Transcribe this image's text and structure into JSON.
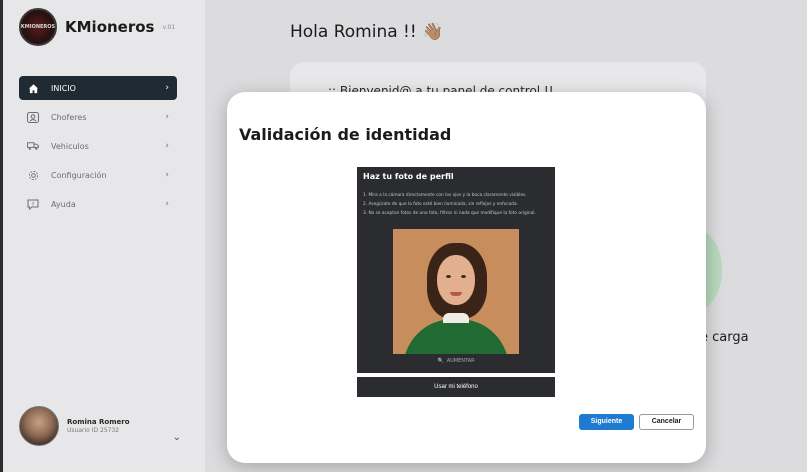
{
  "sidebar": {
    "logo_text": "KMIONEROS",
    "brand": "KMioneros",
    "version": "v.01",
    "items": [
      {
        "label": "INICIO",
        "icon": "home-icon",
        "active": true
      },
      {
        "label": "Choferes",
        "icon": "id-card-icon",
        "active": false
      },
      {
        "label": "Vehiculos",
        "icon": "truck-icon",
        "active": false
      },
      {
        "label": "Configuración",
        "icon": "gear-icon",
        "active": false
      },
      {
        "label": "Ayuda",
        "icon": "chat-help-icon",
        "active": false
      }
    ],
    "chevron": "›",
    "profile": {
      "name": "Romina Romero",
      "id": "Usuario ID 25732",
      "chevron": "⌄"
    }
  },
  "main": {
    "greeting": "Hola Romina !! 👋🏽",
    "welcome": ":: Bienvenid@ a tu panel de control !!",
    "partial_text": "e carga"
  },
  "modal": {
    "title": "Validación de identidad",
    "camera": {
      "title": "Haz tu foto de perfil",
      "rules": [
        "1. Mira a la cámara directamente con los ojos y la boca claramente visibles.",
        "2. Asegúrate de que la foto esté bien iluminada, sin reflejos y enfocada.",
        "3. No se aceptan fotos de una foto, filtros ni nada que modifique la foto original."
      ],
      "zoom_label": "AUMENTAR",
      "zoom_icon": "🔍"
    },
    "phone_button": "Usar mi teléfono",
    "next_button": "Siguiente",
    "cancel_button": "Cancelar"
  },
  "colors": {
    "accent": "#1f7ad1",
    "active_nav": "#202a33",
    "panel_dark": "#2a2c2f"
  }
}
